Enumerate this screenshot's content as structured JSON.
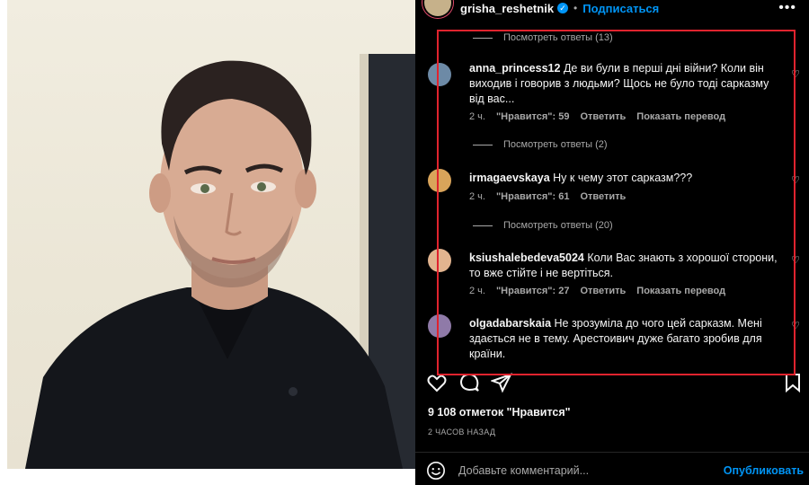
{
  "post": {
    "username": "grisha_reshetnik",
    "follow_label": "Подписаться",
    "more_label": "•••"
  },
  "comments": [
    {
      "user": "anna_princess12",
      "text": "Де ви були в перші дні війни? Коли він виходив і говорив з людьми? Щось не було тоді сарказму від вас...",
      "time": "2 ч.",
      "likes": "\"Нравится\": 59",
      "reply": "Ответить",
      "translate": "Показать перевод",
      "avatar_color": "#6d8aa6"
    },
    {
      "user": "irmagaevskaya",
      "text": "Ну к чему этот сарказм???",
      "time": "2 ч.",
      "likes": "\"Нравится\": 61",
      "reply": "Ответить",
      "translate": "",
      "avatar_color": "#d9a45a"
    },
    {
      "user": "ksiushalebedeva5024",
      "text": "Коли Вас знають з хорошої сторони, то вже стійте і не вертіться.",
      "time": "2 ч.",
      "likes": "\"Нравится\": 27",
      "reply": "Ответить",
      "translate": "Показать перевод",
      "avatar_color": "#e2b48f"
    },
    {
      "user": "olgadabarskaia",
      "text": "Не зрозуміла до чого цей сарказм. Мені здається не в тему. Арестоивич дуже багато зробив для країни.",
      "time": "",
      "likes": "",
      "reply": "",
      "translate": "",
      "avatar_color": "#8f7aa8"
    }
  ],
  "view_replies": [
    "Посмотреть ответы (13)",
    "Посмотреть ответы (2)",
    "Посмотреть ответы (20)"
  ],
  "likes_count": "9 108 отметок \"Нравится\"",
  "time_ago": "2 ЧАСОВ НАЗАД",
  "add_comment": {
    "placeholder": "Добавьте комментарий...",
    "publish": "Опубликовать"
  },
  "colors": {
    "annotation_border": "#e0232e",
    "link_blue": "#0095f6",
    "panel_bg": "#000000"
  }
}
